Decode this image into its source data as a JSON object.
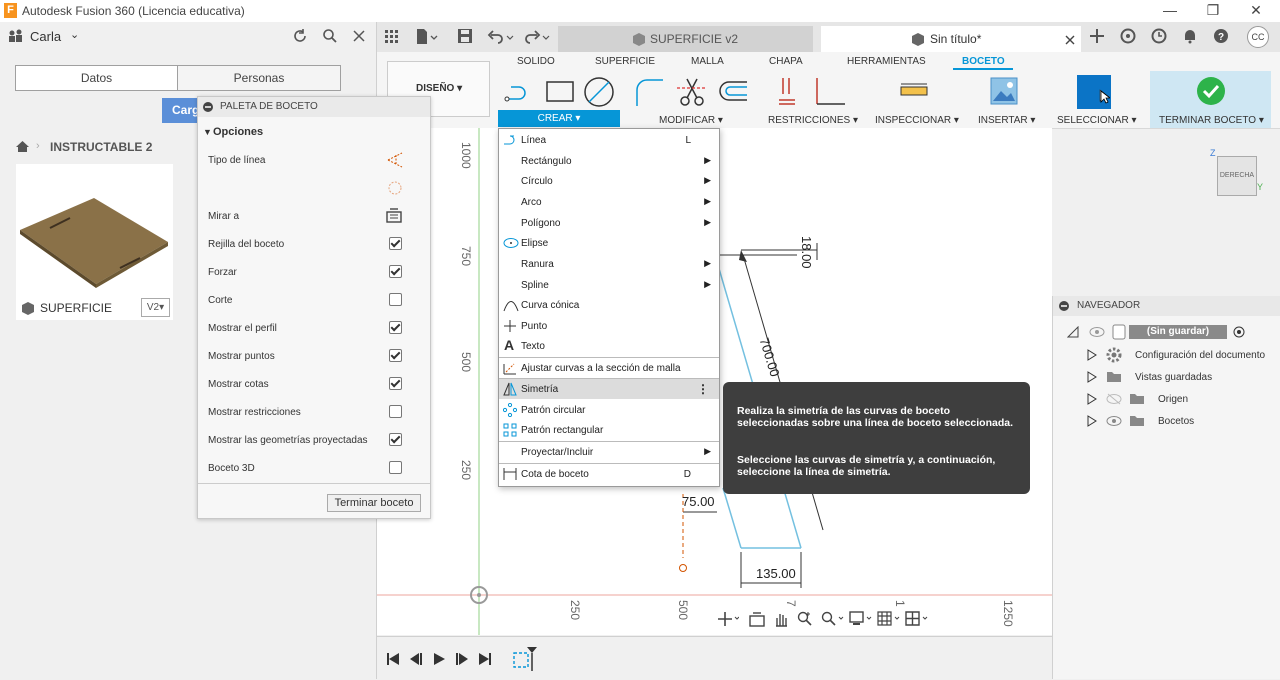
{
  "window": {
    "title": "Autodesk Fusion 360 (Licencia educativa)",
    "logo": "F",
    "min": "—",
    "max": "❐",
    "close": "✕"
  },
  "user": {
    "name": "Carla"
  },
  "data_panel": {
    "tab_data": "Datos",
    "tab_people": "Personas",
    "upload_button": "Carg",
    "breadcrumb": "INSTRUCTABLE 2",
    "item_name": "SUPERFICIE",
    "item_version": "V2▾"
  },
  "doc_tabs": [
    {
      "label": "SUPERFICIE v2"
    },
    {
      "label": "Sin título*"
    }
  ],
  "workspace": {
    "label": "DISEÑO ▾"
  },
  "ribbon_tabs": [
    "SOLIDO",
    "SUPERFICIE",
    "MALLA",
    "CHAPA",
    "HERRAMIENTAS",
    "BOCETO"
  ],
  "ribbon_groups": {
    "create": "CREAR ▾",
    "modify": "MODIFICAR ▾",
    "constraints": "RESTRICCIONES ▾",
    "inspect": "INSPECCIONAR ▾",
    "insert": "INSERTAR ▾",
    "select": "SELECCIONAR ▾",
    "finish": "TERMINAR BOCETO ▾"
  },
  "palette": {
    "title": "PALETA DE BOCETO",
    "section": "Opciones",
    "rows": [
      {
        "label": "Tipo de línea",
        "kind": "icon"
      },
      {
        "label": "",
        "kind": "icon2"
      },
      {
        "label": "Mirar a",
        "kind": "icon3"
      },
      {
        "label": "Rejilla del boceto",
        "checked": true
      },
      {
        "label": "Forzar",
        "checked": true
      },
      {
        "label": "Corte",
        "checked": false
      },
      {
        "label": "Mostrar el perfil",
        "checked": true
      },
      {
        "label": "Mostrar puntos",
        "checked": true
      },
      {
        "label": "Mostrar cotas",
        "checked": true
      },
      {
        "label": "Mostrar restricciones",
        "checked": false
      },
      {
        "label": "Mostrar las geometrías proyectadas",
        "checked": true
      },
      {
        "label": "Boceto 3D",
        "checked": false
      }
    ],
    "finish_button": "Terminar boceto"
  },
  "create_menu": {
    "items": [
      {
        "label": "Línea",
        "shortcut": "L",
        "icon": "line-icon"
      },
      {
        "label": "Rectángulo",
        "submenu": true
      },
      {
        "label": "Círculo",
        "submenu": true
      },
      {
        "label": "Arco",
        "submenu": true
      },
      {
        "label": "Polígono",
        "submenu": true
      },
      {
        "label": "Elipse",
        "icon": "ellipse-icon"
      },
      {
        "label": "Ranura",
        "submenu": true
      },
      {
        "label": "Spline",
        "submenu": true
      },
      {
        "label": "Curva cónica",
        "icon": "conic-curve-icon"
      },
      {
        "label": "Punto",
        "icon": "point-icon"
      },
      {
        "label": "Texto",
        "icon": "text-icon"
      },
      {
        "label": "Ajustar curvas a la sección de malla",
        "icon": "mesh-section-icon",
        "sep_before": true
      },
      {
        "label": "Simetría",
        "icon": "mirror-icon",
        "sep_before": true,
        "highlight": true
      },
      {
        "label": "Patrón circular",
        "icon": "circular-pattern-icon"
      },
      {
        "label": "Patrón rectangular",
        "icon": "rectangular-pattern-icon"
      },
      {
        "label": "Proyectar/Incluir",
        "submenu": true,
        "sep_before": true
      },
      {
        "label": "Cota de boceto",
        "shortcut": "D",
        "icon": "dimension-icon",
        "sep_before": true
      }
    ],
    "more": "⋮"
  },
  "tooltip": {
    "p1": "Realiza la simetría de las curvas de boceto seleccionadas sobre una línea de boceto seleccionada.",
    "p2": "Seleccione las curvas de simetría y, a continuación, seleccione la línea de simetría."
  },
  "canvas": {
    "ruler_v": [
      "1000",
      "750",
      "500",
      "250"
    ],
    "ruler_h": [
      "250",
      "500",
      "7",
      "1",
      "1250"
    ],
    "dims": [
      "18.00",
      "700.00",
      "75.00",
      "135.00"
    ],
    "viewcube": "DERECHA",
    "axis_z": "Z",
    "axis_y": "Y"
  },
  "navigator": {
    "title": "NAVEGADOR",
    "root": "(Sin guardar)",
    "items": [
      "Configuración del documento",
      "Vistas guardadas",
      "Origen",
      "Bocetos"
    ]
  },
  "colors": {
    "accent": "#0696d7",
    "finish": "#2db34a",
    "tooltip_bg": "#3e3e3e"
  }
}
